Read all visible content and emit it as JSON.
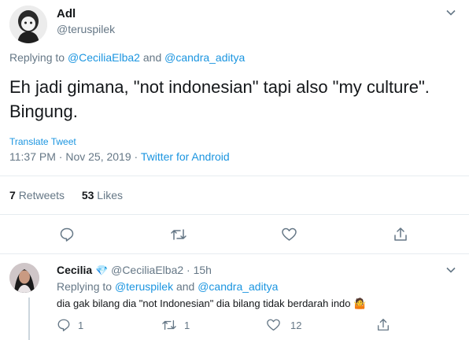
{
  "main_tweet": {
    "display_name": "Adl",
    "handle": "@teruspilek",
    "replying_to_prefix": "Replying to",
    "replying_to_user1": "@CeciliaElba2",
    "replying_to_and": "and",
    "replying_to_user2": "@candra_aditya",
    "text_line1": "Eh jadi gimana, \"not indonesian\" tapi also \"my culture\".",
    "text_line2": "Bingung.",
    "translate": "Translate Tweet",
    "time": "11:37 PM",
    "sep1": "·",
    "date": "Nov 25, 2019",
    "sep2": "·",
    "source": "Twitter for Android",
    "retweets_count": "7",
    "retweets_label": "Retweets",
    "likes_count": "53",
    "likes_label": "Likes"
  },
  "reply": {
    "display_name": "Cecilia",
    "verified_badge": "💎",
    "handle": "@CeciliaElba2",
    "sep": "·",
    "time": "15h",
    "replying_to_prefix": "Replying to",
    "replying_to_user1": "@teruspilek",
    "replying_to_and": "and",
    "replying_to_user2": "@candra_aditya",
    "text": "dia gak bilang dia \"not Indonesian\" dia bilang tidak berdarah indo",
    "emoji": "🤷",
    "reply_count": "1",
    "retweet_count": "1",
    "like_count": "12"
  },
  "icons": {
    "caret": "chevron-down-icon",
    "reply": "reply-icon",
    "retweet": "retweet-icon",
    "like": "heart-icon",
    "share": "share-icon"
  },
  "colors": {
    "link": "#1b95e0",
    "secondary_text": "#657786",
    "icon": "#657786",
    "divider": "#e6ecf0"
  }
}
